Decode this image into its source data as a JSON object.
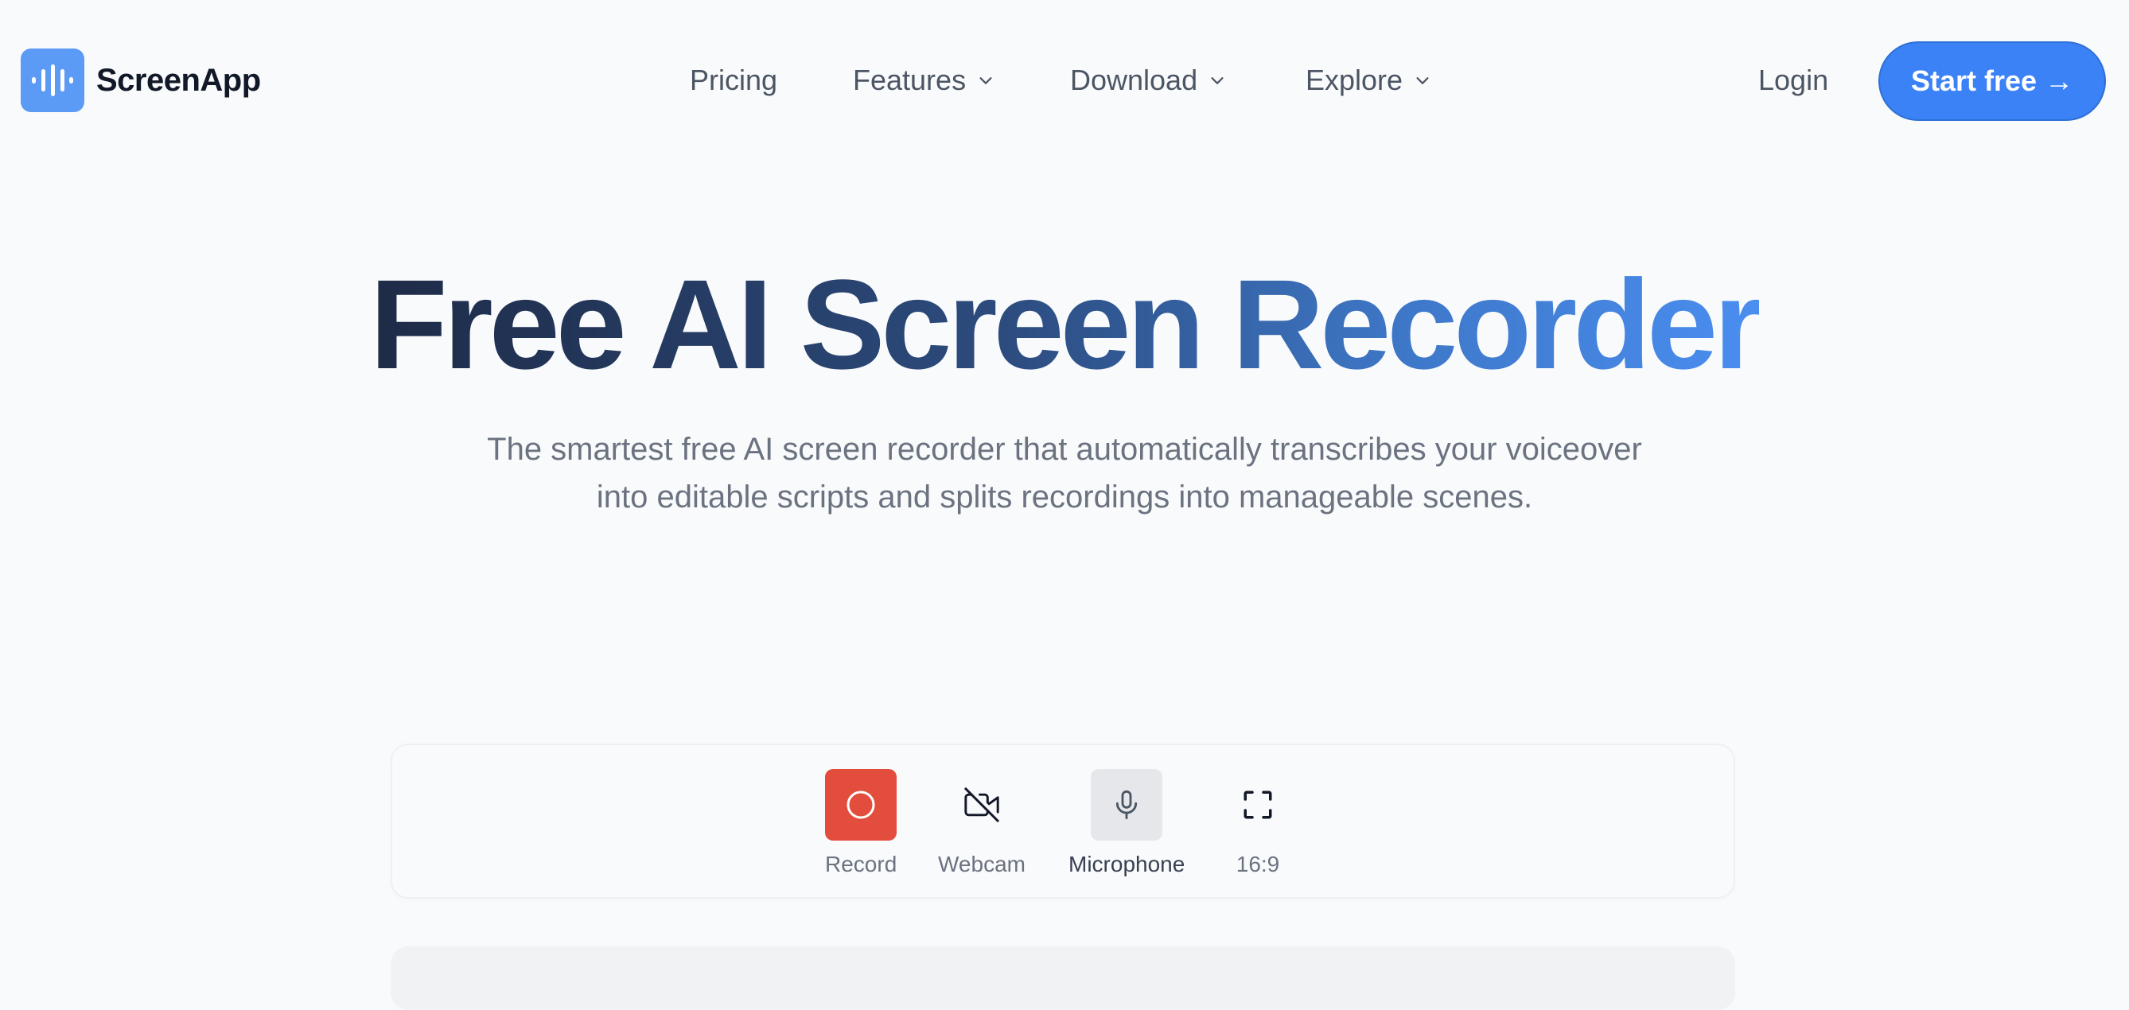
{
  "brand": {
    "name": "ScreenApp",
    "color": "#5b9af5",
    "icon": "sound-wave-icon"
  },
  "nav": {
    "pricing": "Pricing",
    "features": "Features",
    "download": "Download",
    "explore": "Explore"
  },
  "auth": {
    "login": "Login",
    "start": "Start free →"
  },
  "hero": {
    "title": "Free AI Screen Recorder",
    "subtitle_line1": "The smartest free AI screen recorder that automatically transcribes your voiceover",
    "subtitle_line2": "into editable scripts and splits recordings into manageable scenes."
  },
  "recorder": {
    "record": "Record",
    "webcam": "Webcam",
    "microphone": "Microphone",
    "aspect": "16:9",
    "record_color": "#e34d3e",
    "accent": "#3b82f6"
  }
}
